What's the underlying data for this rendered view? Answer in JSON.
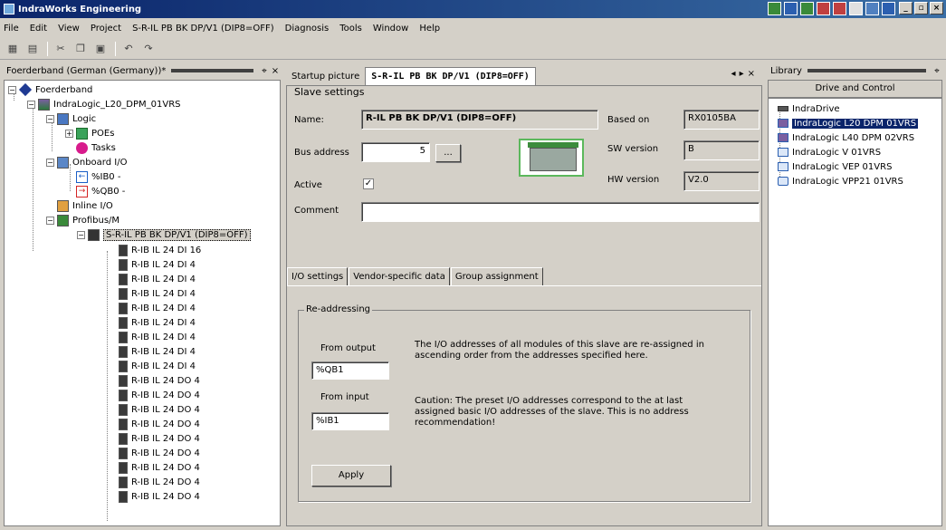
{
  "window": {
    "title": "IndraWorks Engineering"
  },
  "menu": [
    "File",
    "Edit",
    "View",
    "Project",
    "S-R-IL PB BK DP/V1 (DIP8=OFF)",
    "Diagnosis",
    "Tools",
    "Window",
    "Help"
  ],
  "left_pane": {
    "title": "Foerderband (German (Germany))*",
    "tree": {
      "root": "Foerderband",
      "plc": "IndraLogic_L20_DPM_01VRS",
      "logic": "Logic",
      "poes": "POEs",
      "tasks": "Tasks",
      "onboard": "Onboard I/O",
      "ib0": "%IB0 -",
      "qb0": "%QB0 -",
      "inline": "Inline I/O",
      "profibus": "Profibus/M",
      "slave": "S-R-IL PB BK DP/V1 (DIP8=OFF)",
      "modules": [
        "R-IB IL 24 DI 16",
        "R-IB IL 24 DI 4",
        "R-IB IL 24 DI 4",
        "R-IB IL 24 DI 4",
        "R-IB IL 24 DI 4",
        "R-IB IL 24 DI 4",
        "R-IB IL 24 DI 4",
        "R-IB IL 24 DI 4",
        "R-IB IL 24 DI 4",
        "R-IB IL 24 DO 4",
        "R-IB IL 24 DO 4",
        "R-IB IL 24 DO 4",
        "R-IB IL 24 DO 4",
        "R-IB IL 24 DO 4",
        "R-IB IL 24 DO 4",
        "R-IB IL 24 DO 4",
        "R-IB IL 24 DO 4",
        "R-IB IL 24 DO 4"
      ]
    }
  },
  "center": {
    "tabs": [
      "Startup picture",
      "S-R-IL PB BK DP/V1 (DIP8=OFF)"
    ],
    "section_title": "Slave settings",
    "name_label": "Name:",
    "name_value": "R-IL PB BK DP/V1 (DIP8=OFF)",
    "based_on_label": "Based on",
    "based_on_value": "RX0105BA",
    "bus_address_label": "Bus address",
    "bus_address_value": "5",
    "browse_label": "...",
    "sw_version_label": "SW version",
    "sw_version_value": "B",
    "hw_version_label": "HW version",
    "hw_version_value": "V2.0",
    "active_label": "Active",
    "active_check": "✓",
    "comment_label": "Comment",
    "comment_value": "",
    "sub_tabs": [
      "I/O settings",
      "Vendor-specific data",
      "Group assignment"
    ],
    "readdressing": {
      "legend": "Re-addressing",
      "from_output_label": "From output",
      "from_output_value": "%QB1",
      "from_input_label": "From input",
      "from_input_value": "%IB1",
      "info1": "The I/O addresses of all modules of this slave are re-assigned in ascending order from the addresses specified here.",
      "info2": "Caution: The preset I/O addresses correspond to the at last assigned basic I/O addresses of the slave. This is no address recommendation!",
      "apply_label": "Apply"
    }
  },
  "library": {
    "title": "Library",
    "category": "Drive and Control",
    "items": [
      "IndraDrive",
      "IndraLogic L20 DPM 01VRS",
      "IndraLogic L40 DPM 02VRS",
      "IndraLogic V 01VRS",
      "IndraLogic VEP 01VRS",
      "IndraLogic VPP21 01VRS"
    ]
  }
}
